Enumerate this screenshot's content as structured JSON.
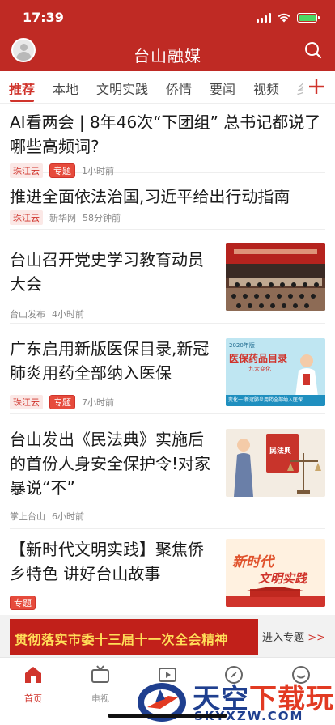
{
  "status_bar": {
    "time": "17:39"
  },
  "header": {
    "title": "台山融媒"
  },
  "channels": [
    "推荐",
    "本地",
    "文明实践",
    "侨情",
    "要闻",
    "视频"
  ],
  "channel_partial": "乡",
  "feed": [
    {
      "title": "AI看两会 | 8年46次“下团组” 总书记都说了哪些高频词?",
      "source": "珠江云",
      "topic": "专题",
      "time": "1小时前"
    },
    {
      "title": "推进全面依法治国,习近平给出行动指南",
      "source": "珠江云",
      "source2": "新华网",
      "time": "58分钟前"
    },
    {
      "title": "台山召开党史学习教育动员大会",
      "source": "台山发布",
      "time": "4小时前"
    },
    {
      "title": "广东启用新版医保目录,新冠肺炎用药全部纳入医保",
      "source": "珠江云",
      "topic": "专题",
      "time": "7小时前",
      "thumb_text": "医保药品目录",
      "thumb_sub": "九大变化",
      "thumb_year": "2020年版",
      "thumb_bottom": "变化一:新冠肺炎用药全部纳入医保"
    },
    {
      "title": "台山发出《民法典》实施后的首份人身安全保护令!对家暴说“不”",
      "source": "掌上台山",
      "time": "6小时前",
      "thumb_text": "民法典"
    },
    {
      "title": "【新时代文明实践】聚焦侨乡特色 讲好台山故事",
      "topic": "专题",
      "thumb_text_a": "新时代",
      "thumb_text_b": "文明实践"
    }
  ],
  "banner": {
    "text": "贯彻落实市委十三届十一次全会精神",
    "link": "进入专题",
    "arrows": ">>"
  },
  "tabbar": [
    {
      "label": "首页",
      "icon": "home-icon"
    },
    {
      "label": "电视",
      "icon": "tv-icon"
    },
    {
      "label": "",
      "icon": "video-icon"
    },
    {
      "label": "",
      "icon": "compass-icon"
    },
    {
      "label": "",
      "icon": "service-icon"
    }
  ],
  "watermark": {
    "main_a": "天空",
    "main_b": "下载玩",
    "sub": "SKYXZW.COM"
  },
  "colors": {
    "brand_red": "#bf2a24",
    "accent_red": "#d0342c"
  }
}
